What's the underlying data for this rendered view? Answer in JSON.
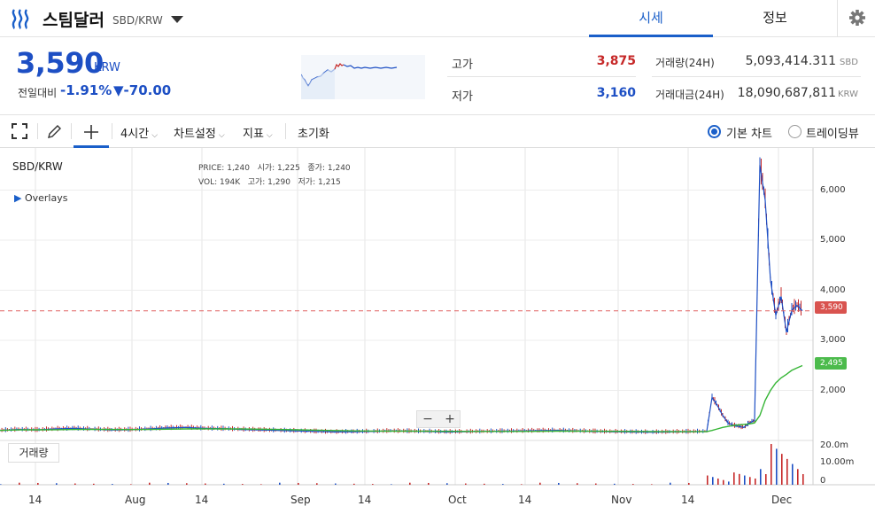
{
  "header": {
    "coin_name": "스팀달러",
    "pair": "SBD/KRW",
    "tabs": [
      "시세",
      "정보"
    ]
  },
  "summary": {
    "price": "3,590",
    "unit": "KRW",
    "change_label": "전일대비",
    "change_pct": "-1.91%",
    "change_abs": "▼-70.00",
    "high_label": "고가",
    "high": "3,875",
    "low_label": "저가",
    "low": "3,160",
    "volume_label": "거래량(24H)",
    "volume": "5,093,414.311",
    "volume_unit": "SBD",
    "amount_label": "거래대금(24H)",
    "amount": "18,090,687,811",
    "amount_unit": "KRW"
  },
  "toolbar": {
    "interval": "4시간",
    "chart_settings": "차트설정",
    "indicators": "지표",
    "reset": "초기화",
    "basic_chart": "기본 차트",
    "tradingview": "트레이딩뷰"
  },
  "chart": {
    "pair": "SBD/KRW",
    "overlays": "Overlays",
    "ohlc": {
      "price_label": "PRICE:",
      "price": "1,240",
      "open_label": "시가:",
      "open": "1,225",
      "close_label": "종가:",
      "close": "1,240",
      "vol_label": "VOL:",
      "vol": "194K",
      "high_label": "고가:",
      "high": "1,290",
      "low_label": "저가:",
      "low": "1,215"
    },
    "volume_tab": "거래량",
    "zoom_out": "−",
    "zoom_in": "+",
    "price_tag": "3,590",
    "ma_tag": "2,495",
    "colors": {
      "up": "#c62828",
      "down": "#1d4fc4",
      "ma": "#35b535",
      "tag_red": "#d9534f",
      "tag_green": "#4cbb4c"
    }
  },
  "chart_data": {
    "type": "line",
    "x_ticks": [
      "14",
      "Aug",
      "14",
      "Sep",
      "14",
      "Oct",
      "14",
      "Nov",
      "14",
      "Dec"
    ],
    "y_ticks": [
      "6,000",
      "5,000",
      "4,000",
      "3,000",
      "2,000"
    ],
    "volume_ticks": [
      "20.0m",
      "10.00m",
      "0"
    ],
    "ylim": [
      1000,
      6700
    ],
    "current_price": 3590,
    "ma_last": 2495,
    "series": [
      {
        "values": [
          1200,
          1220,
          1210,
          1230,
          1240,
          1225,
          1210,
          1215,
          1230,
          1250,
          1260,
          1240,
          1235,
          1220,
          1210,
          1200,
          1190,
          1180,
          1170,
          1175,
          1180,
          1190,
          1185,
          1180,
          1170,
          1175,
          1180,
          1185,
          1190,
          1195,
          1200,
          1190,
          1180,
          1175,
          1170,
          1165,
          1170,
          1175,
          1180,
          1860,
          1700,
          1500,
          1350,
          1300,
          1280,
          1260,
          1350,
          1400,
          6500,
          5800,
          4200,
          3500,
          3875,
          3160,
          3600,
          3700,
          3590
        ]
      },
      {
        "values": [
          1200,
          1210,
          1212,
          1215,
          1220,
          1222,
          1220,
          1218,
          1220,
          1225,
          1230,
          1232,
          1230,
          1228,
          1225,
          1220,
          1212,
          1205,
          1198,
          1192,
          1188,
          1186,
          1185,
          1184,
          1182,
          1181,
          1180,
          1180,
          1181,
          1183,
          1185,
          1185,
          1184,
          1182,
          1180,
          1178,
          1176,
          1175,
          1176,
          1200,
          1230,
          1260,
          1280,
          1300,
          1310,
          1320,
          1330,
          1350,
          1500,
          1800,
          2000,
          2150,
          2250,
          2320,
          2400,
          2450,
          2495
        ]
      }
    ]
  }
}
